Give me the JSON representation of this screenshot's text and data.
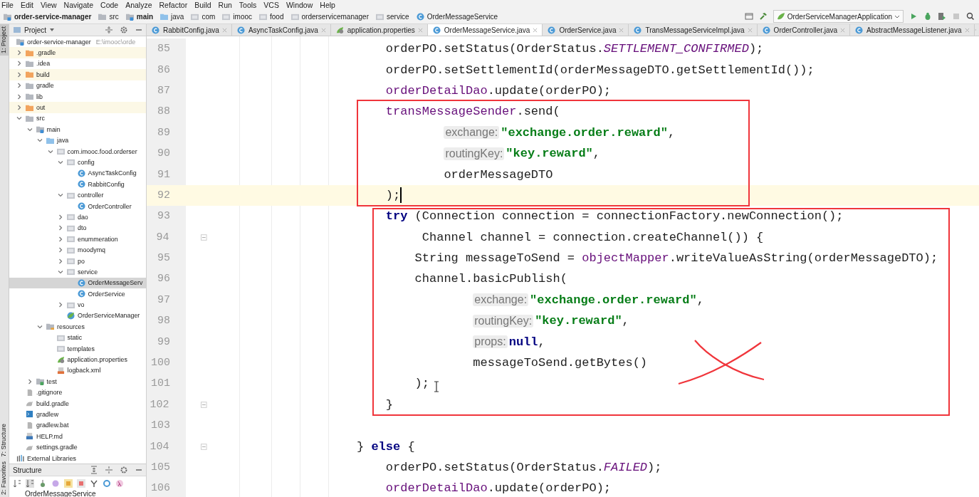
{
  "menu": [
    "File",
    "Edit",
    "View",
    "Navigate",
    "Code",
    "Analyze",
    "Refactor",
    "Build",
    "Run",
    "Tools",
    "VCS",
    "Window",
    "Help"
  ],
  "breadcrumbs": [
    {
      "label": "order-service-manager",
      "kind": "module",
      "bold": true
    },
    {
      "label": "src",
      "kind": "folder",
      "bold": false
    },
    {
      "label": "main",
      "kind": "module",
      "bold": true
    },
    {
      "label": "java",
      "kind": "source",
      "bold": false
    },
    {
      "label": "com",
      "kind": "package",
      "bold": false
    },
    {
      "label": "imooc",
      "kind": "package",
      "bold": false
    },
    {
      "label": "food",
      "kind": "package",
      "bold": false
    },
    {
      "label": "orderservicemanager",
      "kind": "package",
      "bold": false
    },
    {
      "label": "service",
      "kind": "package",
      "bold": false
    },
    {
      "label": "OrderMessageService",
      "kind": "class",
      "bold": false
    }
  ],
  "run_config": {
    "label": "OrderServiceManagerApplication"
  },
  "project_panel": {
    "title": "Project"
  },
  "side_strip": [
    {
      "label": "1: Project",
      "selected": true
    },
    {
      "label": "7: Structure",
      "selected": false
    },
    {
      "label": "2: Favorites",
      "selected": false
    }
  ],
  "tree": [
    {
      "label": "order-service-manager",
      "path": "E:\\imooc\\orde",
      "kind": "module",
      "selected": false,
      "children": [
        {
          "label": ".gradle",
          "kind": "excluded",
          "expanded": false,
          "selected": false
        },
        {
          "label": ".idea",
          "kind": "folder",
          "expanded": false,
          "selected": false
        },
        {
          "label": "build",
          "kind": "excluded",
          "expanded": false,
          "selected": false
        },
        {
          "label": "gradle",
          "kind": "folder",
          "expanded": false,
          "selected": false
        },
        {
          "label": "lib",
          "kind": "folder",
          "expanded": false,
          "selected": false
        },
        {
          "label": "out",
          "kind": "excluded",
          "expanded": false,
          "selected": false
        },
        {
          "label": "src",
          "kind": "folder",
          "expanded": true,
          "selected": false,
          "children": [
            {
              "label": "main",
              "kind": "module",
              "expanded": true,
              "selected": false,
              "children": [
                {
                  "label": "java",
                  "kind": "source",
                  "expanded": true,
                  "selected": false,
                  "children": [
                    {
                      "label": "com.imooc.food.orderser",
                      "kind": "package",
                      "expanded": true,
                      "selected": false,
                      "children": [
                        {
                          "label": "config",
                          "kind": "package",
                          "expanded": true,
                          "selected": false,
                          "children": [
                            {
                              "label": "AsyncTaskConfig",
                              "kind": "class",
                              "selected": false
                            },
                            {
                              "label": "RabbitConfig",
                              "kind": "class",
                              "selected": false
                            }
                          ]
                        },
                        {
                          "label": "controller",
                          "kind": "package",
                          "expanded": true,
                          "selected": false,
                          "children": [
                            {
                              "label": "OrderController",
                              "kind": "class",
                              "selected": false
                            }
                          ]
                        },
                        {
                          "label": "dao",
                          "kind": "package",
                          "expanded": false,
                          "selected": false
                        },
                        {
                          "label": "dto",
                          "kind": "package",
                          "expanded": false,
                          "selected": false
                        },
                        {
                          "label": "enummeration",
                          "kind": "package",
                          "expanded": false,
                          "selected": false
                        },
                        {
                          "label": "moodymq",
                          "kind": "package",
                          "expanded": false,
                          "selected": false
                        },
                        {
                          "label": "po",
                          "kind": "package",
                          "expanded": false,
                          "selected": false
                        },
                        {
                          "label": "service",
                          "kind": "package",
                          "expanded": true,
                          "selected": false,
                          "children": [
                            {
                              "label": "OrderMessageServ",
                              "kind": "class",
                              "selected": true
                            },
                            {
                              "label": "OrderService",
                              "kind": "class",
                              "selected": false
                            }
                          ]
                        },
                        {
                          "label": "vo",
                          "kind": "package",
                          "expanded": false,
                          "selected": false
                        },
                        {
                          "label": "OrderServiceManager",
                          "kind": "app",
                          "selected": false
                        }
                      ]
                    }
                  ]
                },
                {
                  "label": "resources",
                  "kind": "resources",
                  "expanded": true,
                  "selected": false,
                  "children": [
                    {
                      "label": "static",
                      "kind": "package",
                      "selected": false
                    },
                    {
                      "label": "templates",
                      "kind": "package",
                      "selected": false
                    },
                    {
                      "label": "application.properties",
                      "kind": "properties",
                      "selected": false
                    },
                    {
                      "label": "logback.xml",
                      "kind": "xml",
                      "selected": false
                    }
                  ]
                }
              ]
            },
            {
              "label": "test",
              "kind": "test",
              "expanded": false,
              "selected": false
            }
          ]
        },
        {
          "label": ".gitignore",
          "kind": "file",
          "selected": false
        },
        {
          "label": "build.gradle",
          "kind": "gradle",
          "selected": false
        },
        {
          "label": "gradlew",
          "kind": "script",
          "selected": false
        },
        {
          "label": "gradlew.bat",
          "kind": "file",
          "selected": false
        },
        {
          "label": "HELP.md",
          "kind": "markdown",
          "selected": false
        },
        {
          "label": "settings.gradle",
          "kind": "gradle",
          "selected": false
        }
      ]
    },
    {
      "label": "External Libraries",
      "kind": "library",
      "selected": false
    }
  ],
  "structure_panel": {
    "title": "Structure",
    "item": "OrderMessageService"
  },
  "tabs": [
    {
      "label": "RabbitConfig.java",
      "kind": "class",
      "selected": false
    },
    {
      "label": "AsyncTaskConfig.java",
      "kind": "class",
      "selected": false
    },
    {
      "label": "application.properties",
      "kind": "properties",
      "selected": false
    },
    {
      "label": "OrderMessageService.java",
      "kind": "class",
      "selected": true
    },
    {
      "label": "OrderService.java",
      "kind": "class",
      "selected": false
    },
    {
      "label": "TransMessageServiceImpl.java",
      "kind": "class",
      "selected": false
    },
    {
      "label": "OrderController.java",
      "kind": "class",
      "selected": false
    },
    {
      "label": "AbstractMessageListener.java",
      "kind": "class",
      "selected": false
    }
  ],
  "code": [
    {
      "number": "85",
      "current": false,
      "fold": false,
      "tokens": [
        {
          "kind": "plain",
          "text": "    orderPO.setStatus(OrderStatus."
        },
        {
          "kind": "constant",
          "text": "SETTLEMENT_CONFIRMED"
        },
        {
          "kind": "plain",
          "text": ");"
        }
      ]
    },
    {
      "number": "86",
      "current": false,
      "fold": false,
      "tokens": [
        {
          "kind": "plain",
          "text": "    orderPO.setSettlementId(orderMessageDTO.getSettlementId());"
        }
      ]
    },
    {
      "number": "87",
      "current": false,
      "fold": false,
      "tokens": [
        {
          "kind": "field",
          "text": "    orderDetailDao"
        },
        {
          "kind": "plain",
          "text": ".update(orderPO);"
        }
      ]
    },
    {
      "number": "88",
      "current": false,
      "fold": false,
      "tokens": [
        {
          "kind": "field",
          "text": "    transMessageSender"
        },
        {
          "kind": "plain",
          "text": ".send("
        }
      ]
    },
    {
      "number": "89",
      "current": false,
      "fold": false,
      "tokens": [
        {
          "kind": "hint",
          "text": "            exchange:"
        },
        {
          "kind": "string",
          "text": "\"exchange.order.reward\""
        },
        {
          "kind": "plain",
          "text": ","
        }
      ]
    },
    {
      "number": "90",
      "current": false,
      "fold": false,
      "tokens": [
        {
          "kind": "hint",
          "text": "            routingKey:"
        },
        {
          "kind": "string",
          "text": "\"key.reward\""
        },
        {
          "kind": "plain",
          "text": ","
        }
      ]
    },
    {
      "number": "91",
      "current": false,
      "fold": false,
      "tokens": [
        {
          "kind": "plain",
          "text": "            orderMessageDTO"
        }
      ]
    },
    {
      "number": "92",
      "current": true,
      "fold": false,
      "tokens": [
        {
          "kind": "plain",
          "text": "    );"
        }
      ]
    },
    {
      "number": "93",
      "current": false,
      "fold": false,
      "tokens": [
        {
          "kind": "keyword",
          "text": "    try"
        },
        {
          "kind": "plain",
          "text": " (Connection connection = connectionFactory.newConnection();"
        }
      ]
    },
    {
      "number": "94",
      "current": false,
      "fold": true,
      "tokens": [
        {
          "kind": "plain",
          "text": "         Channel channel = connection.createChannel()) {"
        }
      ]
    },
    {
      "number": "95",
      "current": false,
      "fold": false,
      "tokens": [
        {
          "kind": "plain",
          "text": "        String messageToSend = "
        },
        {
          "kind": "field",
          "text": "objectMapper"
        },
        {
          "kind": "plain",
          "text": ".writeValueAsString(orderMessageDTO);"
        }
      ]
    },
    {
      "number": "96",
      "current": false,
      "fold": false,
      "tokens": [
        {
          "kind": "plain",
          "text": "        channel.basicPublish("
        }
      ]
    },
    {
      "number": "97",
      "current": false,
      "fold": false,
      "tokens": [
        {
          "kind": "hint",
          "text": "                exchange:"
        },
        {
          "kind": "string",
          "text": "\"exchange.order.reward\""
        },
        {
          "kind": "plain",
          "text": ","
        }
      ]
    },
    {
      "number": "98",
      "current": false,
      "fold": false,
      "tokens": [
        {
          "kind": "hint",
          "text": "                routingKey:"
        },
        {
          "kind": "string",
          "text": "\"key.reward\""
        },
        {
          "kind": "plain",
          "text": ","
        }
      ]
    },
    {
      "number": "99",
      "current": false,
      "fold": false,
      "tokens": [
        {
          "kind": "hint",
          "text": "                props:"
        },
        {
          "kind": "keyword",
          "text": "null"
        },
        {
          "kind": "plain",
          "text": ","
        }
      ]
    },
    {
      "number": "100",
      "current": false,
      "fold": false,
      "tokens": [
        {
          "kind": "plain",
          "text": "                messageToSend.getBytes()"
        }
      ]
    },
    {
      "number": "101",
      "current": false,
      "fold": false,
      "tokens": [
        {
          "kind": "plain",
          "text": "        );"
        }
      ]
    },
    {
      "number": "102",
      "current": false,
      "fold": true,
      "tokens": [
        {
          "kind": "plain",
          "text": "    }"
        }
      ]
    },
    {
      "number": "103",
      "current": false,
      "fold": false
    },
    {
      "number": "104",
      "current": false,
      "fold": true,
      "tokens": [
        {
          "kind": "plain",
          "text": "} "
        },
        {
          "kind": "keyword",
          "text": "else"
        },
        {
          "kind": "plain",
          "text": " {"
        }
      ]
    },
    {
      "number": "105",
      "current": false,
      "fold": false,
      "tokens": [
        {
          "kind": "plain",
          "text": "    orderPO.setStatus(OrderStatus."
        },
        {
          "kind": "constant",
          "text": "FAILED"
        },
        {
          "kind": "plain",
          "text": ");"
        }
      ]
    },
    {
      "number": "106",
      "current": false,
      "fold": false,
      "tokens": [
        {
          "kind": "field",
          "text": "    orderDetailDao"
        },
        {
          "kind": "plain",
          "text": ".update(orderPO);"
        }
      ]
    }
  ]
}
